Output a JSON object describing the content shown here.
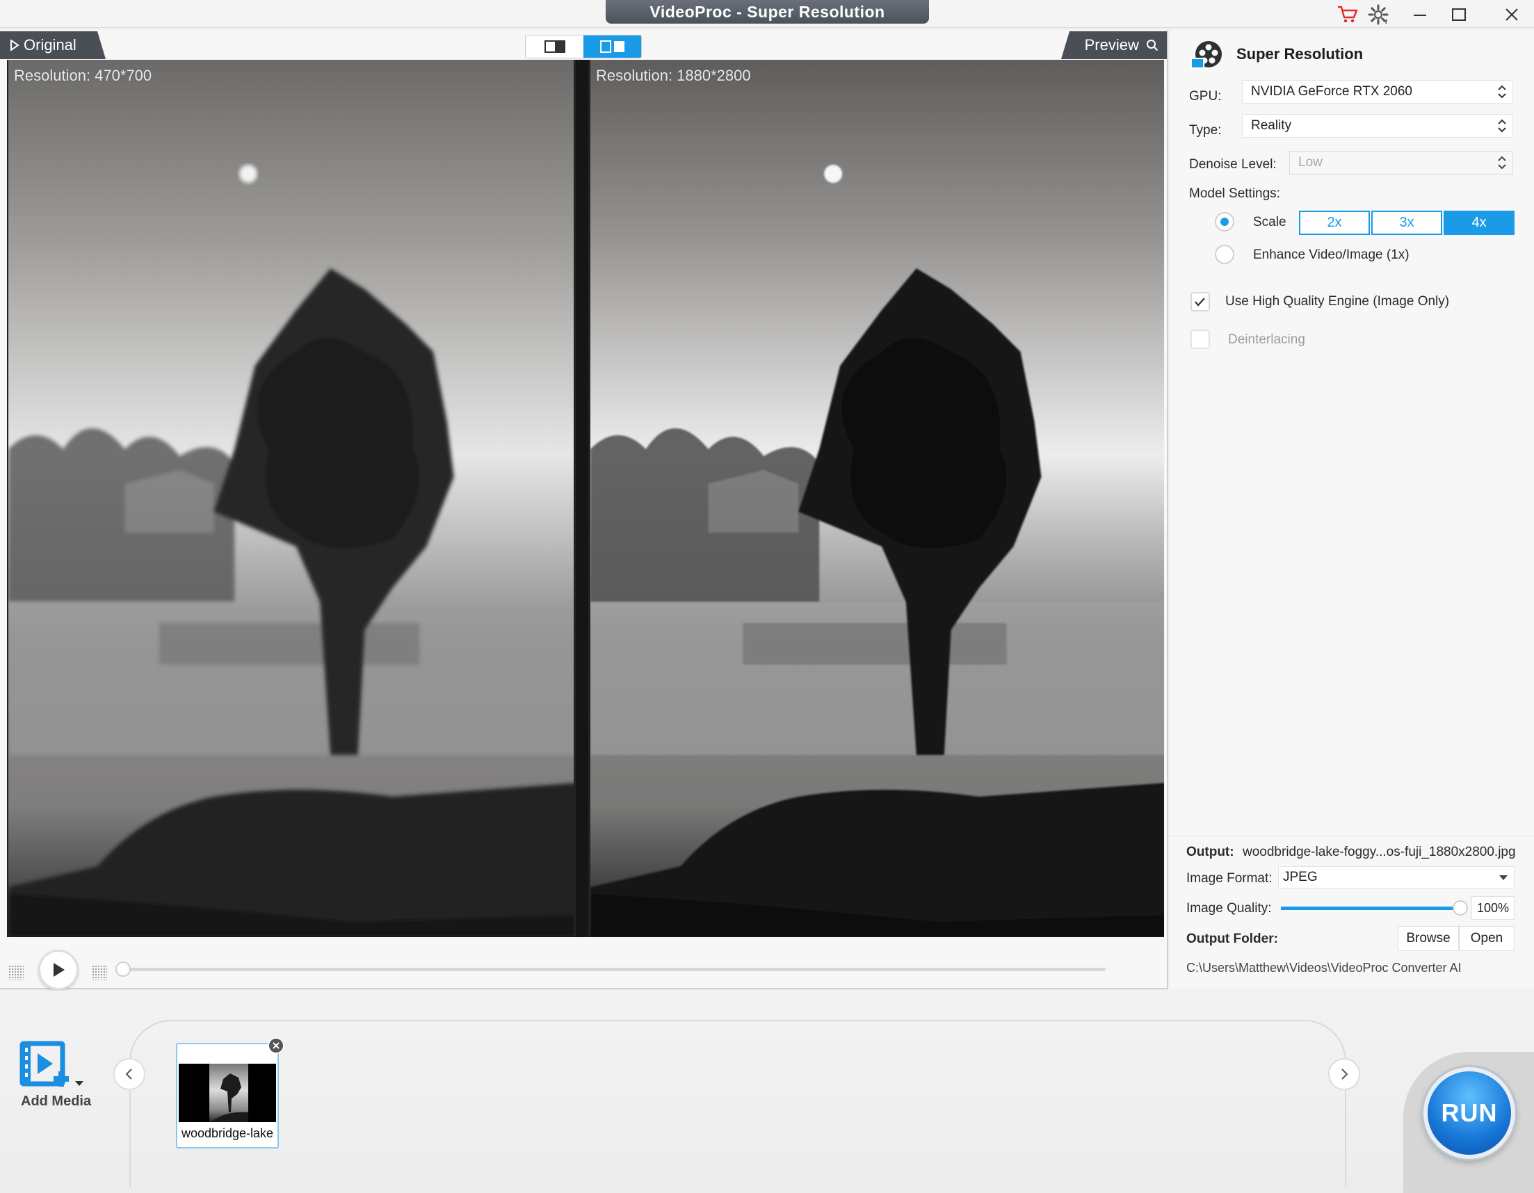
{
  "window": {
    "title": "VideoProc -  Super Resolution",
    "icons": {
      "cart": "cart-icon",
      "settings": "gear-icon",
      "minimize": "minimize-icon",
      "maximize": "maximize-icon",
      "close": "close-icon"
    },
    "accent_color": "#1a9be8"
  },
  "preview": {
    "tab_original": "Original",
    "tab_preview": "Preview",
    "left_resolution": "Resolution: 470*700",
    "right_resolution": "Resolution: 1880*2800",
    "view_mode_selected": "side-by-side",
    "progress": 0
  },
  "settings": {
    "title": "Super Resolution",
    "gpu_label": "GPU:",
    "gpu_value": "NVIDIA GeForce RTX 2060",
    "type_label": "Type:",
    "type_value": "Reality",
    "denoise_label": "Denoise Level:",
    "denoise_value": "Low",
    "model_settings_label": "Model Settings:",
    "scale_label": "Scale",
    "scale_selected": true,
    "scale_options": [
      "2x",
      "3x",
      "4x"
    ],
    "scale_value": "4x",
    "enhance_label": "Enhance Video/Image (1x)",
    "enhance_selected": false,
    "high_quality_label": "Use High Quality Engine (Image Only)",
    "high_quality_checked": true,
    "deinterlacing_label": "Deinterlacing",
    "deinterlacing_checked": false
  },
  "output": {
    "output_label": "Output:",
    "output_file": "woodbridge-lake-foggy...os-fuji_1880x2800.jpg",
    "format_label": "Image Format:",
    "format_value": "JPEG",
    "quality_label": "Image Quality:",
    "quality_value": "100%",
    "quality_fraction": 1.0,
    "folder_label": "Output Folder:",
    "browse_label": "Browse",
    "open_label": "Open",
    "folder_path": "C:\\Users\\Matthew\\Videos\\VideoProc Converter AI"
  },
  "media": {
    "add_media_label": "Add Media",
    "items": [
      {
        "name": "woodbridge-lake"
      }
    ]
  },
  "run_label": "RUN"
}
